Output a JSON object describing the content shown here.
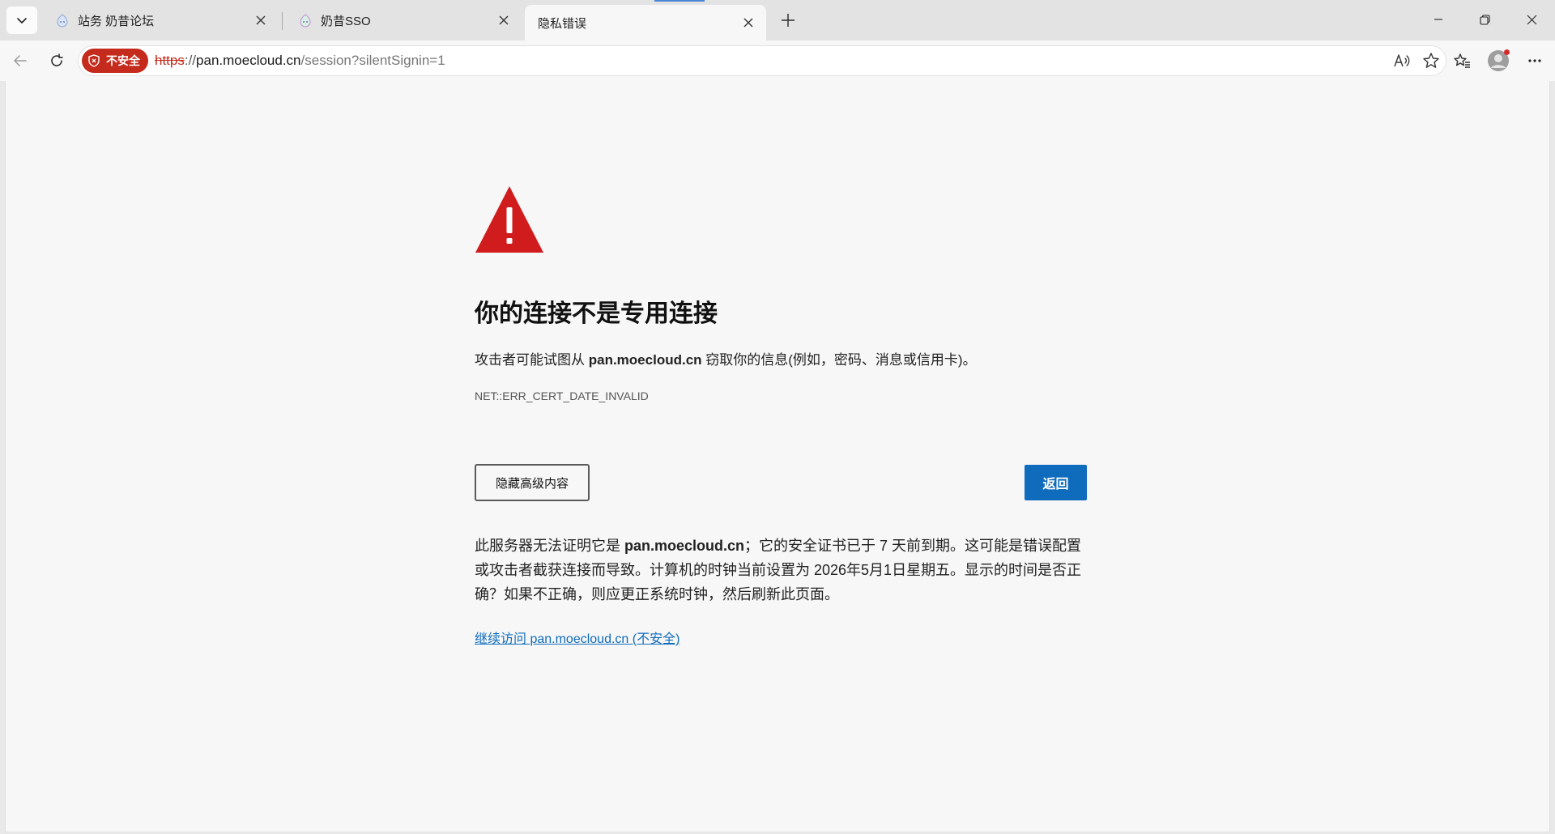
{
  "tabs": [
    {
      "title": "站务 奶昔论坛",
      "favicon": "moe-favicon-icon",
      "active": false
    },
    {
      "title": "奶昔SSO",
      "favicon": "moe-favicon-icon",
      "active": false
    },
    {
      "title": "隐私错误",
      "favicon": null,
      "active": true
    }
  ],
  "addressbar": {
    "badge_label": "不安全",
    "url_scheme": "https",
    "url_sep": "://",
    "url_host": "pan.moecloud.cn",
    "url_path": "/session?silentSignin=1"
  },
  "interstitial": {
    "heading": "你的连接不是专用连接",
    "desc_prefix": "攻击者可能试图从 ",
    "desc_host": "pan.moecloud.cn",
    "desc_suffix": " 窃取你的信息(例如，密码、消息或信用卡)。",
    "error_code": "NET::ERR_CERT_DATE_INVALID",
    "advanced_button": "隐藏高级内容",
    "back_button": "返回",
    "details_prefix": "此服务器无法证明它是 ",
    "details_host": "pan.moecloud.cn",
    "details_suffix": "；它的安全证书已于 7 天前到期。这可能是错误配置或攻击者截获连接而导致。计算机的时钟当前设置为 2026年5月1日星期五。显示的时间是否正确？如果不正确，则应更正系统时钟，然后刷新此页面。",
    "proceed_link": "继续访问 pan.moecloud.cn (不安全)"
  },
  "colors": {
    "danger": "#c42b1c",
    "warning_triangle": "#d01c1c",
    "primary": "#0f6cbd"
  }
}
